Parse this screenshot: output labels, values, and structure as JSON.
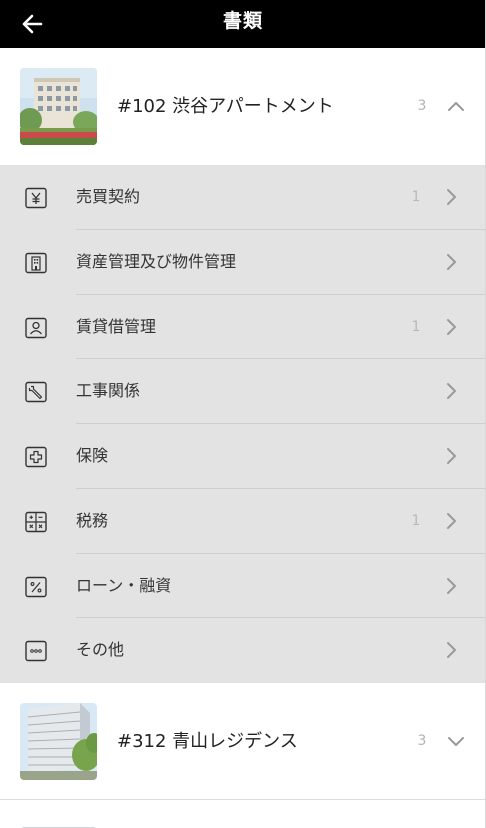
{
  "header": {
    "title": "書類",
    "back_icon": "arrow-left-icon"
  },
  "properties": [
    {
      "name": "#102 渋谷アパートメント",
      "count": "3",
      "expanded": true,
      "toggle_icon": "chevron-up-icon",
      "thumbnail": "building-photo"
    },
    {
      "name": "#312 青山レジデンス",
      "count": "3",
      "expanded": false,
      "toggle_icon": "chevron-down-icon",
      "thumbnail": "building-photo"
    }
  ],
  "categories": [
    {
      "label": "売買契約",
      "count": "1",
      "icon": "yen-icon"
    },
    {
      "label": "資産管理及び物件管理",
      "count": "",
      "icon": "building-icon"
    },
    {
      "label": "賃貸借管理",
      "count": "1",
      "icon": "person-icon"
    },
    {
      "label": "工事関係",
      "count": "",
      "icon": "wrench-icon"
    },
    {
      "label": "保険",
      "count": "",
      "icon": "medical-cross-icon"
    },
    {
      "label": "税務",
      "count": "1",
      "icon": "calculator-icon"
    },
    {
      "label": "ローン・融資",
      "count": "",
      "icon": "percent-icon"
    },
    {
      "label": "その他",
      "count": "",
      "icon": "more-icon"
    }
  ],
  "colors": {
    "header_bg": "#000000",
    "list_bg": "#e3e3e3",
    "count_text": "#b3b3b3"
  }
}
